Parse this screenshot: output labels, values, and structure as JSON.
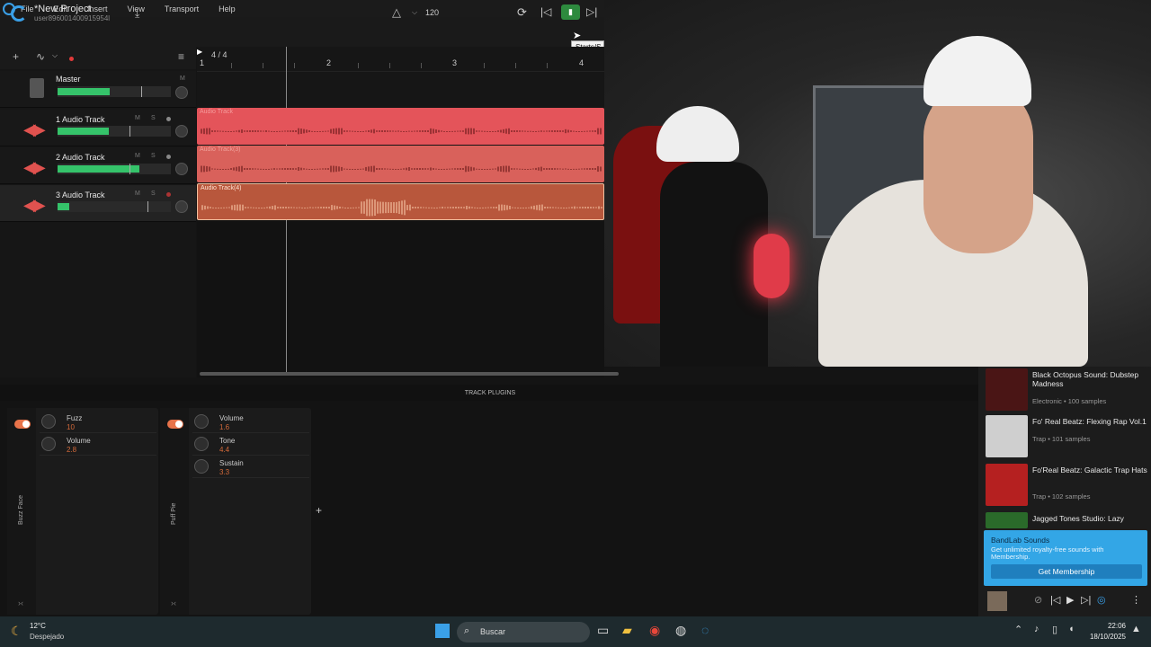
{
  "menu": {
    "items": [
      "File",
      "Edit",
      "Insert",
      "View",
      "Transport",
      "Help"
    ]
  },
  "project": {
    "title": "*New Project",
    "user": "user896001400915954l"
  },
  "transport": {
    "bpm": "120",
    "tooltip": "Starts/S"
  },
  "ruler": {
    "signature": "4 / 4",
    "bars": [
      "1",
      "2",
      "3",
      "4"
    ]
  },
  "master": {
    "label": "Master",
    "m": "M"
  },
  "tracks": [
    {
      "label": "1 Audio Track",
      "meter": 0.45,
      "clip": "Audio Track"
    },
    {
      "label": "2 Audio Track",
      "meter": 0.72,
      "clip": "Audio Track(3)"
    },
    {
      "label": "3 Audio Track",
      "meter": 0.1,
      "clip": "Audio Track(4)"
    }
  ],
  "track_buttons": {
    "m": "M",
    "s": "S"
  },
  "plugins": {
    "header": "TRACK PLUGINS",
    "p1": {
      "name": "Buzz Face",
      "params": [
        {
          "name": "Fuzz",
          "value": "10"
        },
        {
          "name": "Volume",
          "value": "2.8"
        }
      ]
    },
    "p2": {
      "name": "Puff Pie",
      "params": [
        {
          "name": "Volume",
          "value": "1.6"
        },
        {
          "name": "Tone",
          "value": "4.4"
        },
        {
          "name": "Sustain",
          "value": "3.3"
        }
      ]
    }
  },
  "sounds": {
    "packs": [
      {
        "title": "Black Octopus Sound: Dubstep Madness",
        "sub": "Electronic • 100 samples"
      },
      {
        "title": "Fo' Real Beatz: Flexing Rap Vol.1",
        "sub": "Trap • 101 samples"
      },
      {
        "title": "Fo'Real Beatz: Galactic Trap Hats",
        "sub": "Trap • 102 samples"
      },
      {
        "title": "Jagged Tones Studio: Lazy",
        "sub": ""
      }
    ],
    "promo": {
      "title": "BandLab Sounds",
      "text": "Get unlimited royalty-free sounds with Membership.",
      "button": "Get Membership"
    }
  },
  "taskbar": {
    "temp": "12°C",
    "weather": "Despejado",
    "search": "Buscar",
    "time": "22:06",
    "date": "18/10/2025"
  },
  "colors": {
    "accent": "#3aa0e8",
    "clip1": "#e4545a",
    "clip2": "#d9615b",
    "clip3": "#b8573c",
    "meter": "#35c36a",
    "play": "#2d8a3e"
  }
}
